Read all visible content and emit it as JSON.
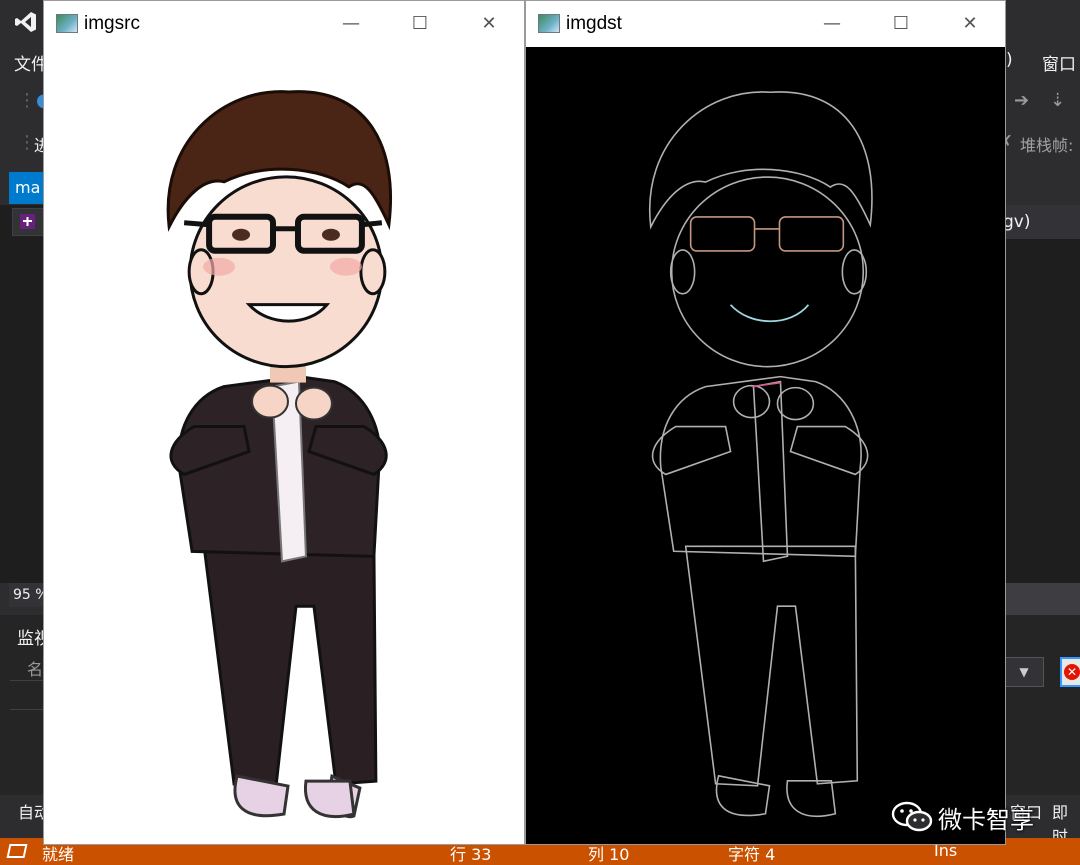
{
  "ide": {
    "menu": {
      "file": "文件",
      "paren": ")",
      "window": "窗口"
    },
    "toolbar": {
      "select_partial": "进",
      "stack_frame": "堆栈帧:"
    },
    "tab": {
      "label": "ma"
    },
    "nav_right": {
      "label": "gv)"
    },
    "zoom": {
      "label": "95 %"
    },
    "watch": {
      "title": "监视",
      "col_name": "名"
    },
    "bottom": {
      "auto": "自动",
      "immediate": "即时",
      "partial_right": "窗口"
    },
    "status": {
      "ready": "就绪",
      "line": "行 33",
      "col": "列 10",
      "char": "字符 4",
      "ins": "Ins"
    }
  },
  "windows": [
    {
      "title": "imgsrc",
      "buttons": {
        "minimize": "—",
        "maximize": "☐",
        "close": "✕"
      }
    },
    {
      "title": "imgdst",
      "buttons": {
        "minimize": "—",
        "maximize": "☐",
        "close": "✕"
      }
    }
  ],
  "watermark": {
    "text": "微卡智享"
  },
  "colors": {
    "ide_bg": "#2d2d30",
    "editor_bg": "#1e1e1e",
    "status_bar": "#ca5100",
    "accent": "#007acc"
  }
}
